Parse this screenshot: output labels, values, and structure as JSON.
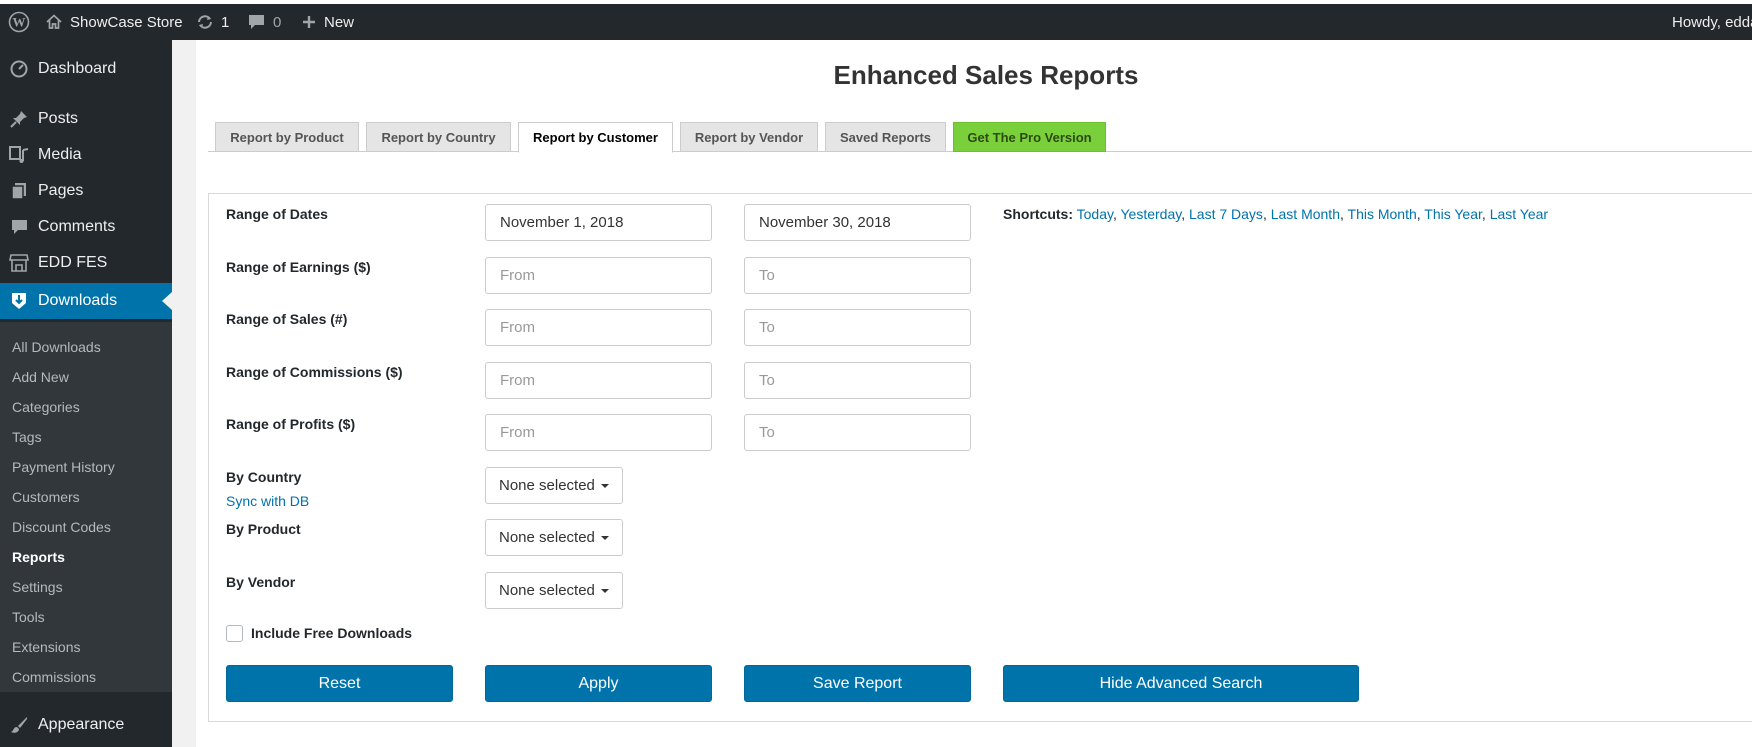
{
  "admin_bar": {
    "site_name": "ShowCase Store",
    "updates_count": "1",
    "comments_count": "0",
    "new_label": "New",
    "howdy": "Howdy, edda"
  },
  "sidebar": {
    "menu": [
      {
        "label": "Dashboard",
        "icon": "dashboard-icon"
      },
      {
        "label": "Posts",
        "icon": "pin-icon"
      },
      {
        "label": "Media",
        "icon": "media-icon"
      },
      {
        "label": "Pages",
        "icon": "pages-icon"
      },
      {
        "label": "Comments",
        "icon": "comment-icon"
      },
      {
        "label": "EDD FES",
        "icon": "store-icon"
      },
      {
        "label": "Downloads",
        "icon": "download-icon"
      }
    ],
    "submenu": [
      "All Downloads",
      "Add New",
      "Categories",
      "Tags",
      "Payment History",
      "Customers",
      "Discount Codes",
      "Reports",
      "Settings",
      "Tools",
      "Extensions",
      "Commissions"
    ],
    "appearance_label": "Appearance"
  },
  "page": {
    "title": "Enhanced Sales Reports",
    "tabs": [
      "Report by Product",
      "Report by Country",
      "Report by Customer",
      "Report by Vendor",
      "Saved Reports",
      "Get The Pro Version"
    ],
    "active_tab": "Report by Customer"
  },
  "form": {
    "range_dates": {
      "label": "Range of Dates",
      "from_value": "November 1, 2018",
      "to_value": "November 30, 2018"
    },
    "range_earnings": {
      "label": "Range of Earnings ($)",
      "from_placeholder": "From",
      "to_placeholder": "To"
    },
    "range_sales": {
      "label": "Range of Sales (#)",
      "from_placeholder": "From",
      "to_placeholder": "To"
    },
    "range_commissions": {
      "label": "Range of Commissions ($)",
      "from_placeholder": "From",
      "to_placeholder": "To"
    },
    "range_profits": {
      "label": "Range of Profits ($)",
      "from_placeholder": "From",
      "to_placeholder": "To"
    },
    "by_country": {
      "label": "By Country",
      "value": "None selected",
      "sync_link": "Sync with DB"
    },
    "by_product": {
      "label": "By Product",
      "value": "None selected"
    },
    "by_vendor": {
      "label": "By Vendor",
      "value": "None selected"
    },
    "include_free": {
      "label": "Include Free Downloads",
      "checked": false
    },
    "shortcuts": {
      "label": "Shortcuts:",
      "links": [
        "Today",
        "Yesterday",
        "Last 7 Days",
        "Last Month",
        "This Month",
        "This Year",
        "Last Year"
      ]
    },
    "buttons": {
      "reset": "Reset",
      "apply": "Apply",
      "save_report": "Save Report",
      "hide_advanced": "Hide Advanced Search"
    }
  },
  "colors": {
    "admin_bar": "#23282d",
    "accent": "#0073aa",
    "pro_tab": "#7ad03a",
    "submenu_bg": "#32373c"
  }
}
